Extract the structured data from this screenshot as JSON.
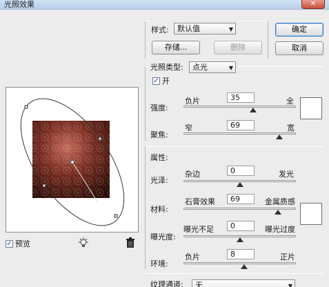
{
  "window": {
    "title": "光照效果",
    "close_glyph": "✕"
  },
  "style": {
    "label": "样式:",
    "value": "默认值",
    "save_label": "存储...",
    "delete_label": "删除"
  },
  "actions": {
    "ok_label": "确定",
    "cancel_label": "取消"
  },
  "light": {
    "type_label": "光照类型:",
    "type_value": "点光",
    "on_label": "开",
    "on_checked": true,
    "intensity": {
      "label": "强度:",
      "min_label": "负片",
      "max_label": "全",
      "value": "35",
      "level": 0.62
    },
    "focus": {
      "label": "聚焦:",
      "min_label": "窄",
      "max_label": "宽",
      "value": "69",
      "level": 0.85
    },
    "color": "#ffffff"
  },
  "properties": {
    "heading": "属性:",
    "gloss": {
      "label": "光泽:",
      "min_label": "杂边",
      "max_label": "发光",
      "value": "0",
      "level": 0.5
    },
    "material": {
      "label": "材料:",
      "min_label": "石膏效果",
      "max_label": "金属质感",
      "value": "69",
      "level": 0.84
    },
    "exposure": {
      "label": "曝光度:",
      "min_label": "曝光不足",
      "max_label": "曝光过度",
      "value": "0",
      "level": 0.5
    },
    "ambience": {
      "label": "环境:",
      "min_label": "负片",
      "max_label": "正片",
      "value": "8",
      "level": 0.54
    },
    "color": "#ffffff"
  },
  "texture": {
    "label": "纹理通道:",
    "value": "无"
  },
  "preview": {
    "checkbox_label": "预览",
    "checked": true,
    "light_icon": "lightbulb-icon",
    "trash_icon": "trash-icon",
    "image_colors": [
      "#2a0d08",
      "#7a2e22",
      "#c46a5a"
    ]
  }
}
